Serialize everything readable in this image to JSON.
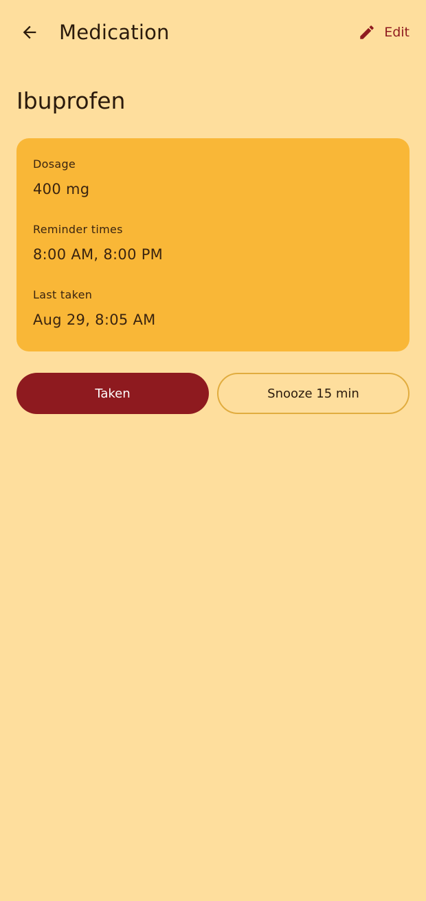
{
  "app_bar": {
    "title": "Medication",
    "back_icon": "arrow-left-icon",
    "edit_icon": "pencil-icon",
    "edit_label": "Edit"
  },
  "medication": {
    "name": "Ibuprofen",
    "details": [
      {
        "label": "Dosage",
        "value": "400 mg"
      },
      {
        "label": "Reminder times",
        "value": "8:00 AM, 8:00 PM"
      },
      {
        "label": "Last taken",
        "value": "Aug 29, 8:05 AM"
      }
    ]
  },
  "actions": {
    "taken_label": "Taken",
    "snooze_label": "Snooze 15 min"
  },
  "colors": {
    "background": "#FEDE9D",
    "card": "#F9B737",
    "primary": "#8E1A1F",
    "outline": "#E1AC3F",
    "text": "#2A1A0C"
  }
}
